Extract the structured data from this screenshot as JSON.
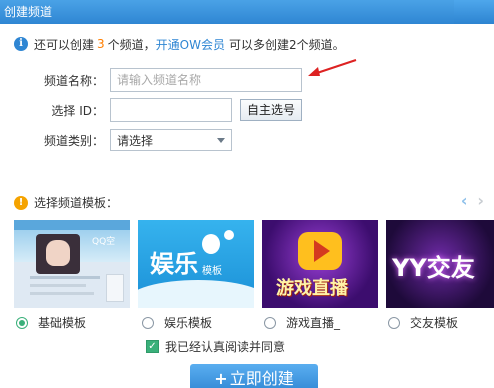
{
  "window": {
    "title": "创建频道"
  },
  "notice": {
    "text_prefix": "还可以创建",
    "count": "3",
    "text_mid": "个频道，",
    "link": "开通OW会员",
    "text_suffix": "可以多创建2个频道。"
  },
  "form": {
    "name_label": "频道名称：",
    "name_placeholder": "请输入频道名称",
    "id_label": "选择 ID：",
    "id_value": "",
    "self_select_button": "自主选号",
    "category_label": "频道类别：",
    "category_value": "请选择"
  },
  "templates": {
    "heading": "选择频道模板：",
    "items": [
      {
        "label": "基础模板",
        "selected": true
      },
      {
        "label": "娱乐模板",
        "selected": false,
        "image_text": "娱乐",
        "image_sub": "模板"
      },
      {
        "label": "游戏直播_",
        "selected": false,
        "image_text": "游戏直播"
      },
      {
        "label": "交友模板",
        "selected": false,
        "image_text": "YY交友"
      }
    ],
    "basic_image_text": "QQ空",
    "prev_arrow": "‹",
    "next_arrow": "›"
  },
  "agree": {
    "label": "我已经认真阅读并同意",
    "checked": true
  },
  "create_button": {
    "plus": "+",
    "label": "立即创建"
  },
  "colors": {
    "primary": "#2f86d3",
    "orange": "#ff7e00",
    "green": "#3ab07a"
  }
}
